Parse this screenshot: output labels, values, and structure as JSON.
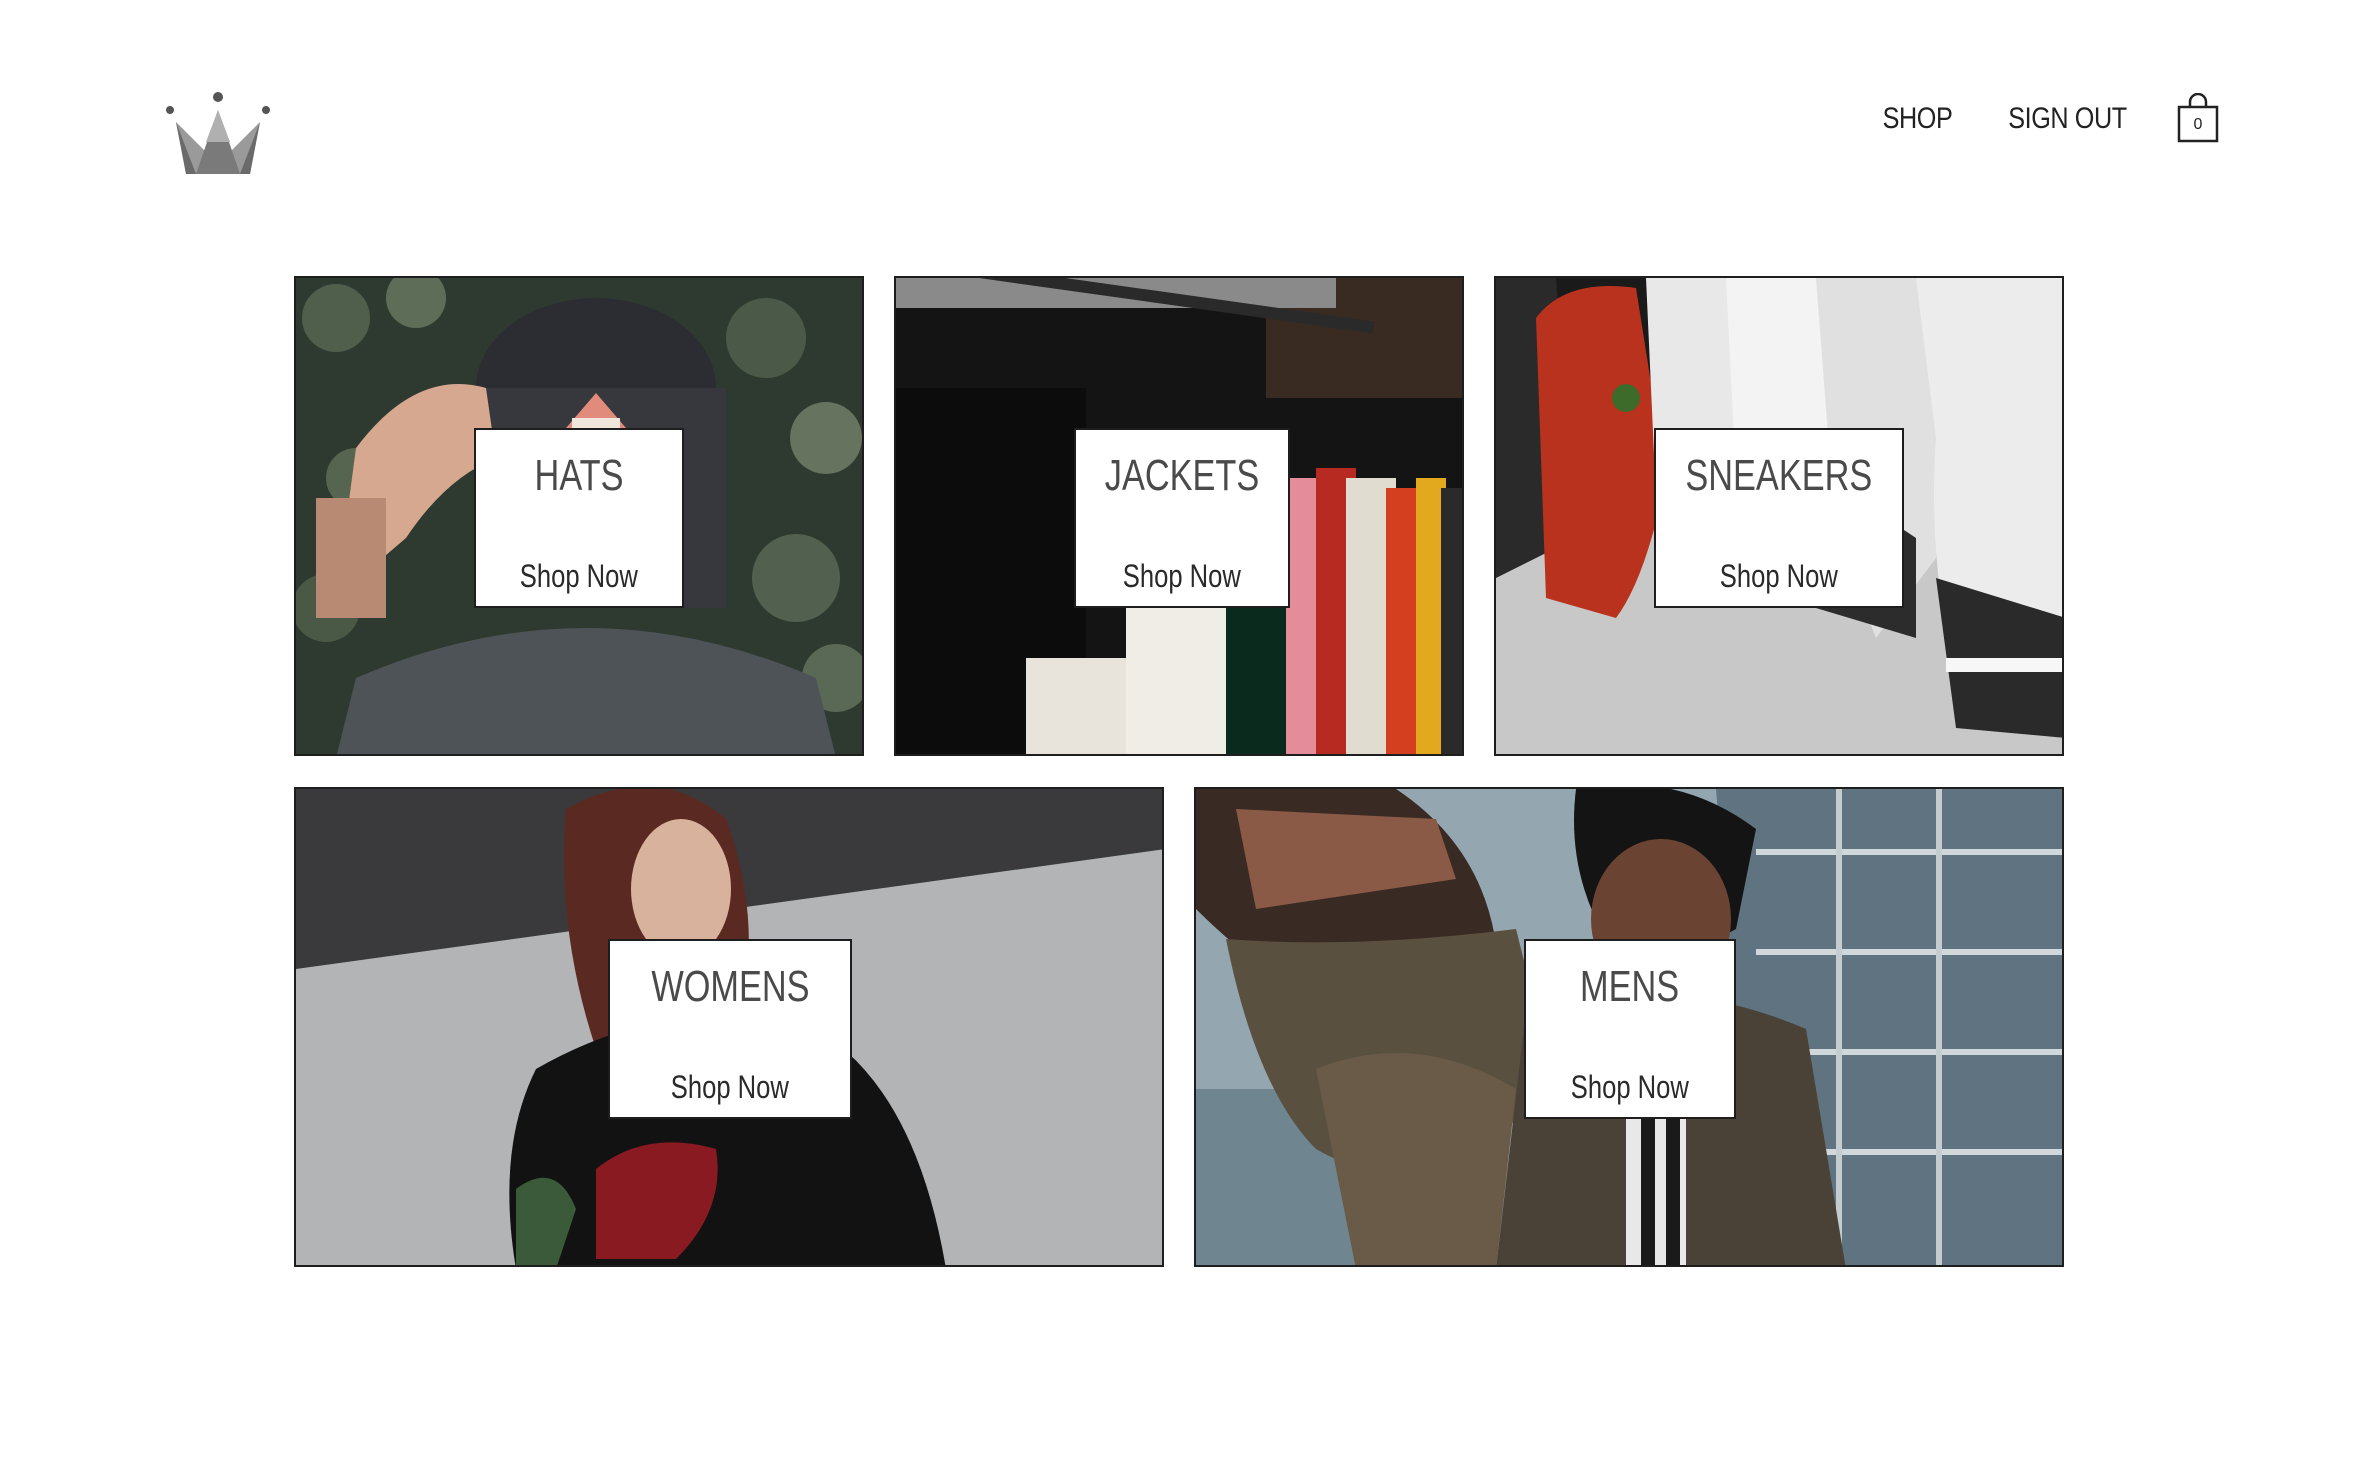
{
  "header": {
    "logo_icon": "crown-icon",
    "nav": {
      "shop_label": "SHOP",
      "signout_label": "SIGN OUT"
    },
    "cart": {
      "icon": "shopping-bag-icon",
      "count": "0"
    }
  },
  "categories": [
    {
      "title": "HATS",
      "cta": "Shop Now"
    },
    {
      "title": "JACKETS",
      "cta": "Shop Now"
    },
    {
      "title": "SNEAKERS",
      "cta": "Shop Now"
    },
    {
      "title": "WOMENS",
      "cta": "Shop Now"
    },
    {
      "title": "MENS",
      "cta": "Shop Now"
    }
  ],
  "colors": {
    "text": "#222222",
    "title_text": "#4a4a4a",
    "border": "#1e1e1e",
    "logo": "#7a7a7a",
    "background": "#ffffff"
  }
}
